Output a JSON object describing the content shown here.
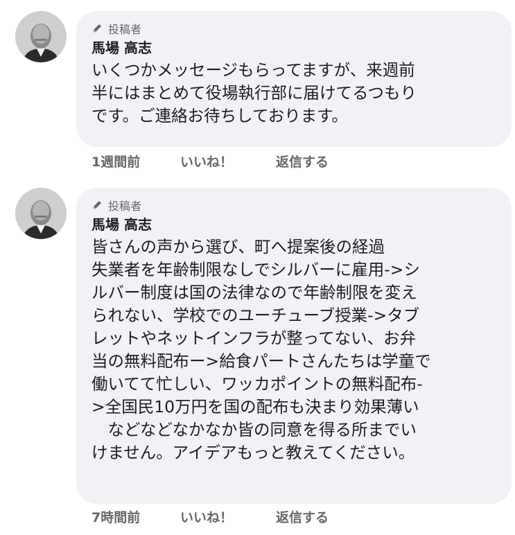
{
  "comments": [
    {
      "badge": "投稿者",
      "author": "馬場 高志",
      "body": "いくつかメッセージもらってますが、来週前\n半にはまとめて役場執行部に届けてるつもり\nです。ご連絡お待ちしております。",
      "time": "1週間前",
      "like": "いいね！",
      "reply": "返信する"
    },
    {
      "badge": "投稿者",
      "author": "馬場 高志",
      "body": "皆さんの声から選び、町へ提案後の経過\n失業者を年齢制限なしでシルバーに雇用->シ\nルバー制度は国の法律なので年齢制限を変え\nられない、学校でのユーチューブ授業->タブ\nレットやネットインフラが整ってない、お弁\n当の無料配布ー>給食パートさんたちは学童で\n働いてて忙しい、ワッカポイントの無料配布-\n>全国民10万円を国の配布も決まり効果薄い\n　などなどなかなか皆の同意を得る所までい\nけません。アイデアもっと教えてください。",
      "time": "7時間前",
      "like": "いいね！",
      "reply": "返信する"
    }
  ],
  "icons": {
    "badge_icon": "pencil-icon",
    "avatar": "profile-photo"
  },
  "colors": {
    "bubble_bg": "#f0f2f5",
    "text": "#1c1e21",
    "muted": "#65676b"
  }
}
